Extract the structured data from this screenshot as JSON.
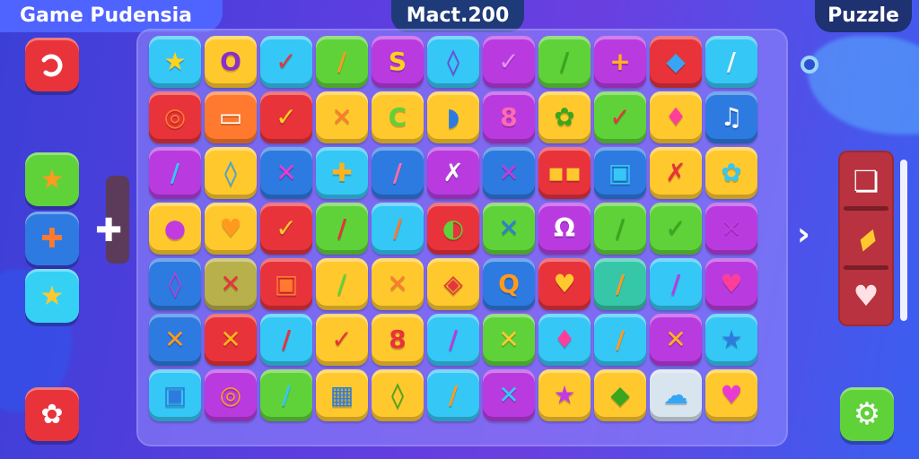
{
  "header": {
    "title": "Game Pudensia",
    "score": "Mact.200",
    "mode": "Puzzle"
  },
  "left_panel": {
    "undo_icon": "undo-icon",
    "buttons": [
      {
        "name": "star-leaf-button",
        "glyph": "★",
        "color": "#5fd23a"
      },
      {
        "name": "gift-button",
        "glyph": "✚",
        "color": "#2d7be0"
      },
      {
        "name": "star-button",
        "glyph": "★",
        "color": "#35d1f5"
      }
    ],
    "bottom_glyph": "✿"
  },
  "board": {
    "rows": [
      [
        {
          "c": "#35c7f5",
          "g": "★",
          "gc": "#ffd21c"
        },
        {
          "c": "#ffc92e",
          "g": "O",
          "gc": "#8b2fc9"
        },
        {
          "c": "#35c7f5",
          "g": "✓",
          "gc": "#e8333b"
        },
        {
          "c": "#5fd23a",
          "g": "/",
          "gc": "#ff9a1f"
        },
        {
          "c": "#b93be0",
          "g": "S",
          "gc": "#ffd21c"
        },
        {
          "c": "#35c7f5",
          "g": "◊",
          "gc": "#7a3fe0"
        },
        {
          "c": "#b93be0",
          "g": "✓",
          "gc": "#e58ef5"
        },
        {
          "c": "#5fd23a",
          "g": "/",
          "gc": "#3aa61e"
        },
        {
          "c": "#b93be0",
          "g": "+",
          "gc": "#ffb21c"
        },
        {
          "c": "#e8333b",
          "g": "◆",
          "gc": "#35a6f5"
        },
        {
          "c": "#35c7f5",
          "g": "/",
          "gc": "#e7f8ff"
        }
      ],
      [
        {
          "c": "#e8333b",
          "g": "◎",
          "gc": "#ff7a2e"
        },
        {
          "c": "#ff7a2e",
          "g": "▭",
          "gc": "#ffffff"
        },
        {
          "c": "#e8333b",
          "g": "✓",
          "gc": "#ffd21c"
        },
        {
          "c": "#ffc92e",
          "g": "✕",
          "gc": "#ff7a2e"
        },
        {
          "c": "#ffc92e",
          "g": "C",
          "gc": "#5fd23a"
        },
        {
          "c": "#ffc92e",
          "g": "◗",
          "gc": "#2d7be0"
        },
        {
          "c": "#b93be0",
          "g": "8",
          "gc": "#ff6ab0"
        },
        {
          "c": "#ffc92e",
          "g": "✿",
          "gc": "#3aa61e"
        },
        {
          "c": "#5fd23a",
          "g": "✓",
          "gc": "#e8333b"
        },
        {
          "c": "#ffc92e",
          "g": "♦",
          "gc": "#ff3e9a"
        },
        {
          "c": "#2d7be0",
          "g": "♫",
          "gc": "#ffffff"
        }
      ],
      [
        {
          "c": "#b93be0",
          "g": "/",
          "gc": "#35c7f5"
        },
        {
          "c": "#ffc92e",
          "g": "◊",
          "gc": "#35a6f5"
        },
        {
          "c": "#2d7be0",
          "g": "✕",
          "gc": "#e83bd2"
        },
        {
          "c": "#35c7f5",
          "g": "✚",
          "gc": "#ffb21c"
        },
        {
          "c": "#2d7be0",
          "g": "/",
          "gc": "#ff6ab0"
        },
        {
          "c": "#b93be0",
          "g": "✗",
          "gc": "#ffffff"
        },
        {
          "c": "#2d7be0",
          "g": "✕",
          "gc": "#c23be0"
        },
        {
          "c": "#e8333b",
          "g": "▪▪",
          "gc": "#ffc92e"
        },
        {
          "c": "#2d7be0",
          "g": "▣",
          "gc": "#35c7f5"
        },
        {
          "c": "#ffc92e",
          "g": "✗",
          "gc": "#e8333b"
        },
        {
          "c": "#ffc92e",
          "g": "✿",
          "gc": "#35c7f5"
        }
      ],
      [
        {
          "c": "#ffc92e",
          "g": "●",
          "gc": "#c23be0"
        },
        {
          "c": "#ffc92e",
          "g": "♥",
          "gc": "#ff9a1f"
        },
        {
          "c": "#e8333b",
          "g": "✓",
          "gc": "#ffc92e"
        },
        {
          "c": "#5fd23a",
          "g": "/",
          "gc": "#e8333b"
        },
        {
          "c": "#35c7f5",
          "g": "/",
          "gc": "#ff7a2e"
        },
        {
          "c": "#e8333b",
          "g": "◐",
          "gc": "#5fd23a"
        },
        {
          "c": "#5fd23a",
          "g": "✕",
          "gc": "#2d7be0"
        },
        {
          "c": "#b93be0",
          "g": "Ω",
          "gc": "#ffffff"
        },
        {
          "c": "#5fd23a",
          "g": "/",
          "gc": "#3aa61e"
        },
        {
          "c": "#5fd23a",
          "g": "✓",
          "gc": "#3aa61e"
        },
        {
          "c": "#b93be0",
          "g": "✕",
          "gc": "#c23be0"
        }
      ],
      [
        {
          "c": "#2d7be0",
          "g": "◊",
          "gc": "#c23be0"
        },
        {
          "c": "#b8b04a",
          "g": "✕",
          "gc": "#e8333b"
        },
        {
          "c": "#e8333b",
          "g": "▣",
          "gc": "#ff7a2e"
        },
        {
          "c": "#ffc92e",
          "g": "/",
          "gc": "#5fd23a"
        },
        {
          "c": "#ffc92e",
          "g": "✕",
          "gc": "#ff7a2e"
        },
        {
          "c": "#ffc92e",
          "g": "◈",
          "gc": "#e8333b"
        },
        {
          "c": "#2d7be0",
          "g": "Q",
          "gc": "#ff9a1f"
        },
        {
          "c": "#e8333b",
          "g": "♥",
          "gc": "#ffc92e"
        },
        {
          "c": "#35c7a8",
          "g": "/",
          "gc": "#ff9a1f"
        },
        {
          "c": "#35c7f5",
          "g": "/",
          "gc": "#b93be0"
        },
        {
          "c": "#b93be0",
          "g": "♥",
          "gc": "#ff3e9a"
        }
      ],
      [
        {
          "c": "#2d7be0",
          "g": "✕",
          "gc": "#ff9a1f"
        },
        {
          "c": "#e8333b",
          "g": "✕",
          "gc": "#ffb21c"
        },
        {
          "c": "#35c7f5",
          "g": "/",
          "gc": "#e8333b"
        },
        {
          "c": "#ffc92e",
          "g": "✓",
          "gc": "#e8333b"
        },
        {
          "c": "#ffc92e",
          "g": "8",
          "gc": "#e8333b"
        },
        {
          "c": "#35c7f5",
          "g": "/",
          "gc": "#b93be0"
        },
        {
          "c": "#5fd23a",
          "g": "✕",
          "gc": "#ffc92e"
        },
        {
          "c": "#35c7f5",
          "g": "♦",
          "gc": "#ff3e9a"
        },
        {
          "c": "#35c7f5",
          "g": "/",
          "gc": "#ff9a1f"
        },
        {
          "c": "#b93be0",
          "g": "✕",
          "gc": "#ffb21c"
        },
        {
          "c": "#35c7f5",
          "g": "★",
          "gc": "#2d7be0"
        }
      ],
      [
        {
          "c": "#35c7f5",
          "g": "▣",
          "gc": "#2d7be0"
        },
        {
          "c": "#b93be0",
          "g": "◎",
          "gc": "#ff9a1f"
        },
        {
          "c": "#5fd23a",
          "g": "/",
          "gc": "#35c7f5"
        },
        {
          "c": "#ffc92e",
          "g": "▦",
          "gc": "#2d7be0"
        },
        {
          "c": "#ffc92e",
          "g": "◊",
          "gc": "#3aa61e"
        },
        {
          "c": "#35c7f5",
          "g": "/",
          "gc": "#ff9a1f"
        },
        {
          "c": "#b93be0",
          "g": "✕",
          "gc": "#35c7f5"
        },
        {
          "c": "#ffc92e",
          "g": "★",
          "gc": "#c23be0"
        },
        {
          "c": "#ffc92e",
          "g": "◆",
          "gc": "#3aa61e"
        },
        {
          "c": "#d8e4ee",
          "g": "☁",
          "gc": "#35a6f5"
        },
        {
          "c": "#ffc92e",
          "g": "♥",
          "gc": "#e83bd2"
        }
      ]
    ]
  },
  "right_panel": {
    "tray": [
      {
        "name": "cards-item",
        "glyph": "❏",
        "color": "#ffffff"
      },
      {
        "name": "bandage-item",
        "glyph": "▰",
        "color": "#ffc92e"
      },
      {
        "name": "heart-item",
        "glyph": "♥",
        "color": "#ffe0e4"
      }
    ],
    "settings_glyph": "⚙"
  },
  "colors": {
    "accent": "#4f63ff",
    "score_bg": "#1e3a79",
    "tray_bg": "#b8323f"
  }
}
